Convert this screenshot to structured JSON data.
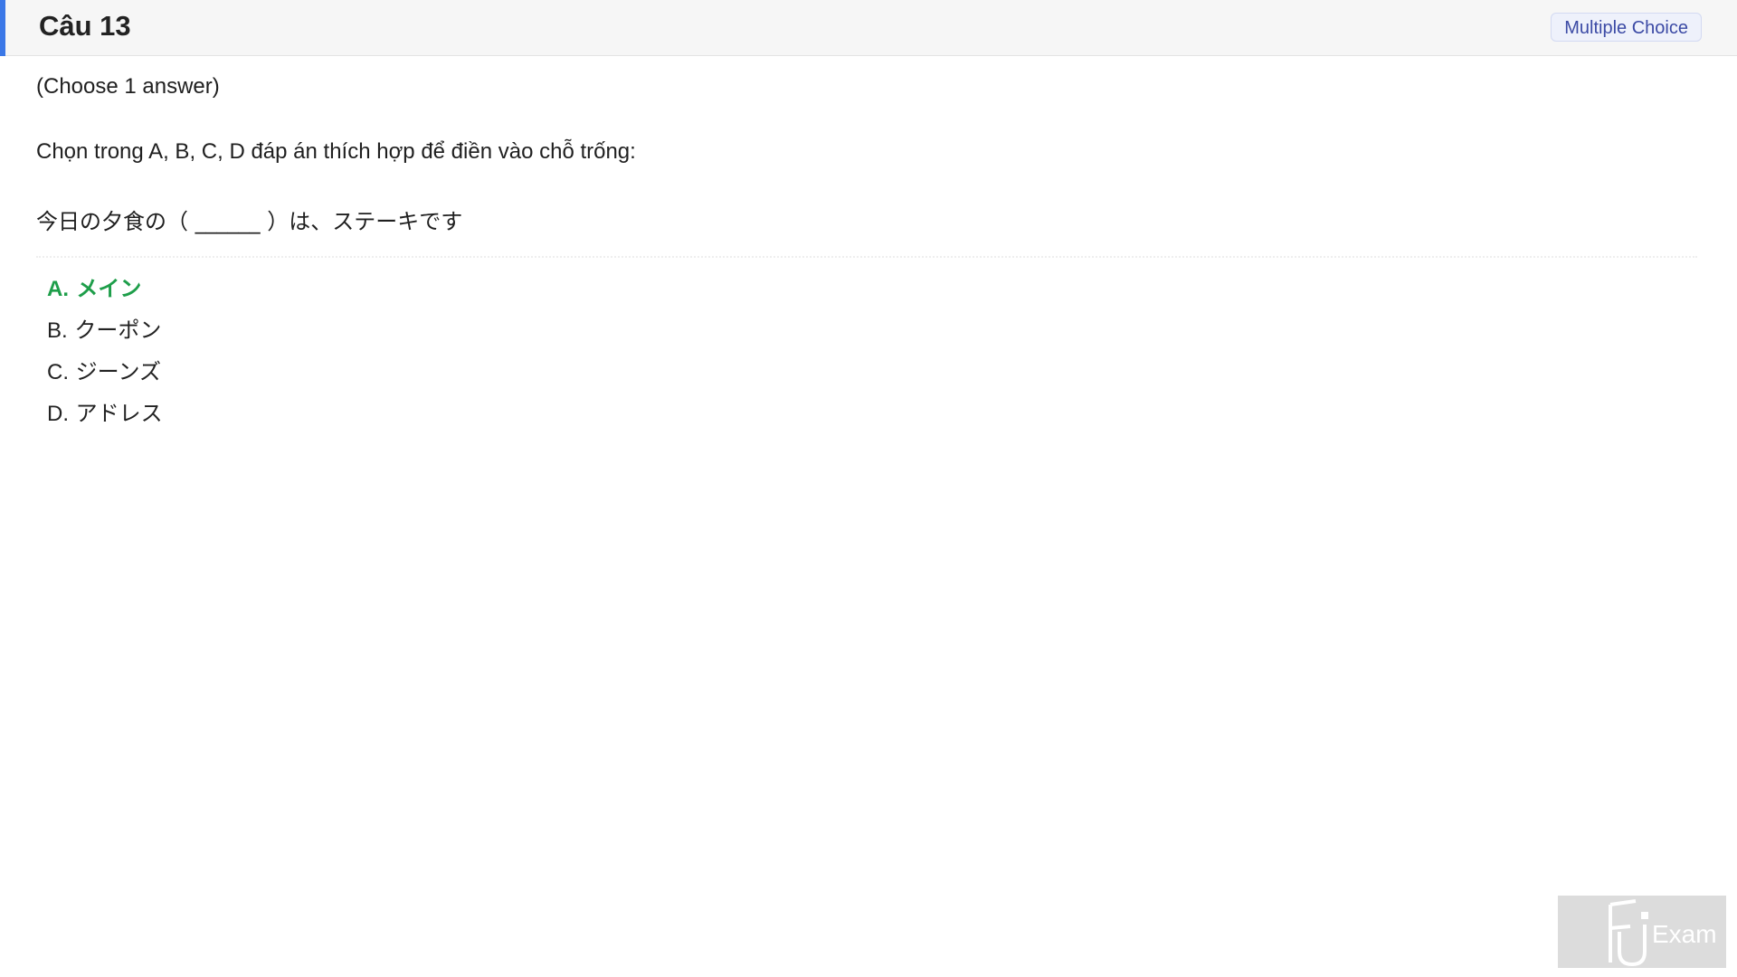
{
  "header": {
    "title": "Câu 13",
    "badge": "Multiple Choice"
  },
  "question": {
    "instruction": "(Choose 1 answer)",
    "prompt": "Chọn trong A, B, C, D đáp án thích hợp để điền vào chỗ trống:",
    "sentence": "今日の夕食の（ ______ ）は、ステーキです"
  },
  "options": [
    {
      "letter": "A.",
      "text": "メイン",
      "correct": true
    },
    {
      "letter": "B.",
      "text": "クーポン",
      "correct": false
    },
    {
      "letter": "C.",
      "text": "ジーンズ",
      "correct": false
    },
    {
      "letter": "D.",
      "text": "アドレス",
      "correct": false
    }
  ],
  "watermark": {
    "text": "Exam",
    "logo_letters": "FU"
  },
  "colors": {
    "accent": "#3b78e7",
    "correct": "#1e9e4a",
    "badge_text": "#3b4aa5"
  }
}
